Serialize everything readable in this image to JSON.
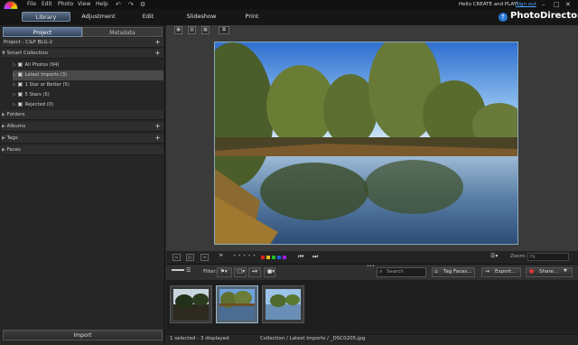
{
  "menu": [
    "File",
    "Edit",
    "Photo",
    "View",
    "Help"
  ],
  "account": {
    "greeting": "Hello CREATE and PLAY!",
    "signout": "Sign out"
  },
  "modules": {
    "library": "Library",
    "adjustment": "Adjustment",
    "edit": "Edit",
    "slideshow": "Slideshow",
    "print": "Print"
  },
  "brand": "PhotoDirector",
  "left_tabs": {
    "project": "Project",
    "metadata": "Metadata"
  },
  "project_title": "Project - C&P BLG-2",
  "smart_collection": {
    "title": "Smart Collection",
    "items": [
      {
        "label": "All Photos (94)"
      },
      {
        "label": "Latest Imports (3)"
      },
      {
        "label": "1 Star or Better (5)"
      },
      {
        "label": "5 Stars (5)"
      },
      {
        "label": "Rejected (0)"
      }
    ]
  },
  "sections": {
    "folders": "Folders",
    "albums": "Albums",
    "tags": "Tags",
    "faces": "Faces"
  },
  "import_button": "Import",
  "viewer_bar": {
    "dots": "• • • • •",
    "zoom_label": "Zoom:",
    "zoom_value": "Fit",
    "label_colors": [
      "#e02020",
      "#e0c020",
      "#20c020",
      "#2060e0",
      "#a020e0"
    ]
  },
  "filter_bar": {
    "filter_label": "Filter:",
    "search_placeholder": "Search",
    "tag_faces": "Tag Faces...",
    "export": "Export...",
    "share": "Share..."
  },
  "status": {
    "left": "1 selected - 3 displayed",
    "right": "Collection / Latest Imports / _DSC0205.jpg"
  }
}
